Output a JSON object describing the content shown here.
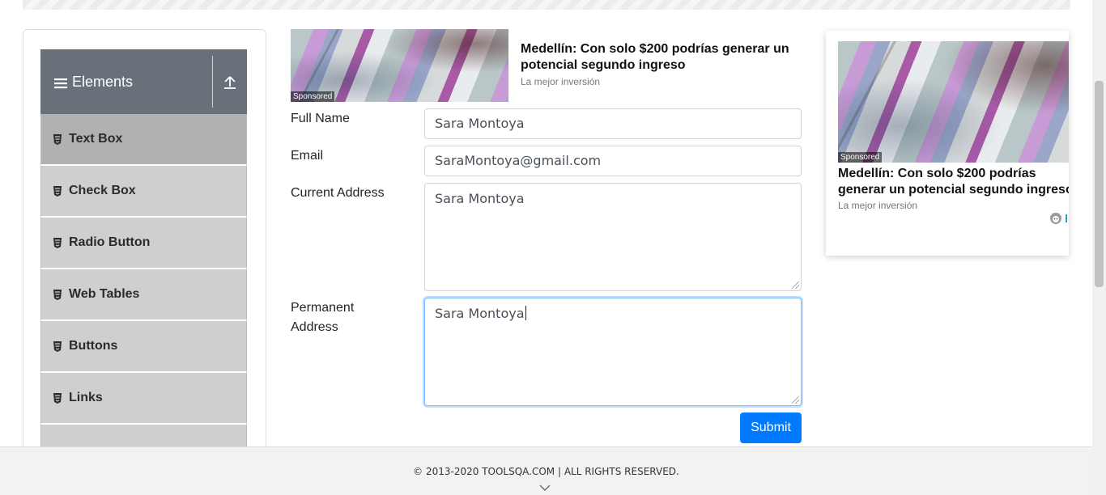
{
  "sidebar": {
    "group_title": "Elements",
    "items": [
      {
        "label": "Text Box",
        "active": true
      },
      {
        "label": "Check Box"
      },
      {
        "label": "Radio Button"
      },
      {
        "label": "Web Tables"
      },
      {
        "label": "Buttons"
      },
      {
        "label": "Links"
      }
    ]
  },
  "ad_top": {
    "sponsored": "Sponsored",
    "headline": "Medellín: Con solo $200 podrías generar un potencial segundo ingreso",
    "brand": "La mejor inversión"
  },
  "ad_right": {
    "sponsored": "Sponsored",
    "headline": "Medellín: Con solo $200 podrías generar un potencial segundo ingreso",
    "brand": "La mejor inversión"
  },
  "form": {
    "full_name_label": "Full Name",
    "full_name_value": "Sara Montoya",
    "email_label": "Email",
    "email_value": "SaraMontoya@gmail.com",
    "current_address_label": "Current Address",
    "current_address_value": "Sara Montoya",
    "permanent_address_label_1": "Permanent",
    "permanent_address_label_2": "Address",
    "permanent_address_value": "Sara Montoya",
    "submit_label": "Submit"
  },
  "footer": {
    "copyright": "© 2013-2020 TOOLSQA.COM | ALL RIGHTS RESERVED."
  },
  "colors": {
    "accent": "#007bff",
    "sidebar_header": "#68717a",
    "menu_item": "#cfcfcf",
    "menu_item_active": "#b1b1b1"
  }
}
